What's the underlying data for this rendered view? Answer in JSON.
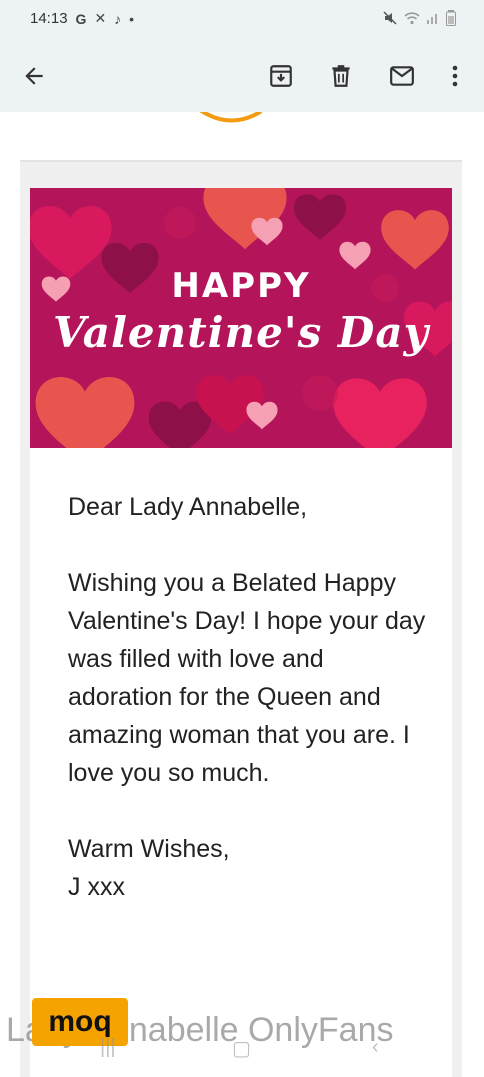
{
  "status_bar": {
    "time": "14:13",
    "left_icons": [
      "google-icon",
      "missed-call-icon",
      "tiktok-icon",
      "dot-icon"
    ],
    "right_icons": [
      "mute-icon",
      "wifi-icon",
      "signal-icon",
      "battery-icon"
    ]
  },
  "toolbar": {
    "icons": [
      "back-arrow-icon",
      "archive-icon",
      "delete-icon",
      "mark-unread-icon",
      "more-vert-icon"
    ]
  },
  "banner": {
    "line1": "HAPPY",
    "line2": "Valentine's Day",
    "background": "#b4145a"
  },
  "email": {
    "greeting": "Dear Lady Annabelle,",
    "body": "Wishing you a Belated Happy Valentine's Day! I hope your day was filled with love and adoration for the Queen and amazing woman that you are. I love you so much.",
    "signoff": "Warm Wishes,",
    "signature": "J xxx"
  },
  "watermark": {
    "logo_text": "moq",
    "text": "Lady Annabelle OnlyFans"
  }
}
